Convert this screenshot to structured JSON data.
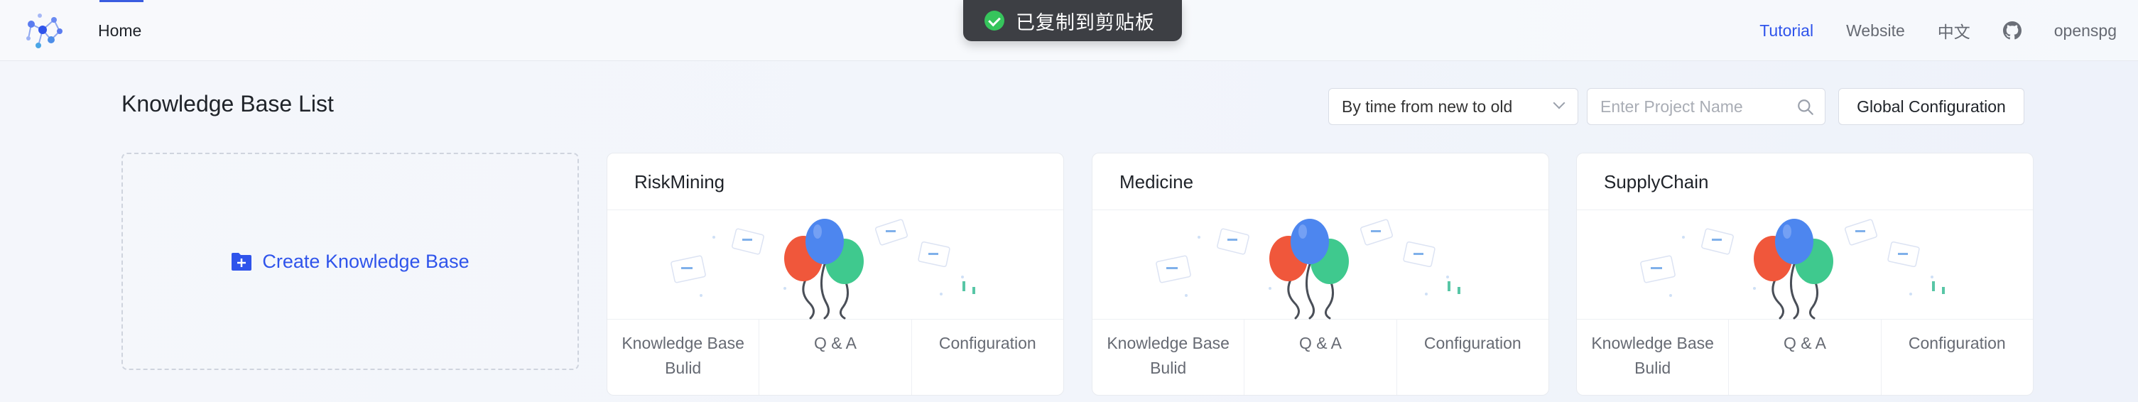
{
  "nav": {
    "home": "Home",
    "links": [
      "Tutorial",
      "Website",
      "中文"
    ],
    "user": "openspg",
    "accent": "#2f54eb"
  },
  "toast": {
    "text": "已复制到剪贴板",
    "icon": "check-circle-icon"
  },
  "header": {
    "title": "Knowledge Base List",
    "sort_value": "By time from new to old",
    "search_placeholder": "Enter Project Name",
    "global_config": "Global Configuration"
  },
  "create_card": {
    "label": "Create Knowledge Base",
    "icon": "folder-plus-icon"
  },
  "cards": [
    {
      "name": "RiskMining",
      "actions": [
        "Knowledge Base Bulid",
        "Q & A",
        "Configuration"
      ]
    },
    {
      "name": "Medicine",
      "actions": [
        "Knowledge Base Bulid",
        "Q & A",
        "Configuration"
      ]
    },
    {
      "name": "SupplyChain",
      "actions": [
        "Knowledge Base Bulid",
        "Q & A",
        "Configuration"
      ]
    }
  ]
}
